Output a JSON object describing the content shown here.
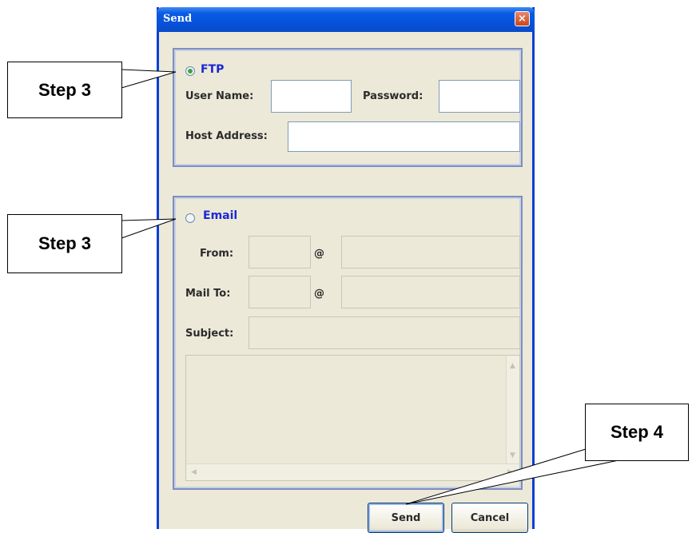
{
  "window": {
    "title": "Send",
    "close_icon": "close-icon"
  },
  "ftp": {
    "radio_label": "FTP",
    "selected": true,
    "user_name_label": "User Name:",
    "user_name_value": "",
    "password_label": "Password:",
    "password_value": "",
    "host_address_label": "Host Address:",
    "host_address_value": ""
  },
  "email": {
    "radio_label": "Email",
    "selected": false,
    "from_label": "From:",
    "from_user_value": "",
    "from_at": "@",
    "from_domain_value": "",
    "mail_to_label": "Mail To:",
    "mail_to_user_value": "",
    "mail_to_at": "@",
    "mail_to_domain_value": "",
    "subject_label": "Subject:",
    "subject_value": "",
    "body_value": ""
  },
  "buttons": {
    "send_label": "Send",
    "cancel_label": "Cancel"
  },
  "callouts": {
    "step3_ftp": "Step 3",
    "step3_email": "Step 3",
    "step4": "Step 4"
  },
  "colors": {
    "titlebar": "#0a5ae4",
    "radio_label": "#1b28d6",
    "dialog_bg": "#ece9d8"
  }
}
